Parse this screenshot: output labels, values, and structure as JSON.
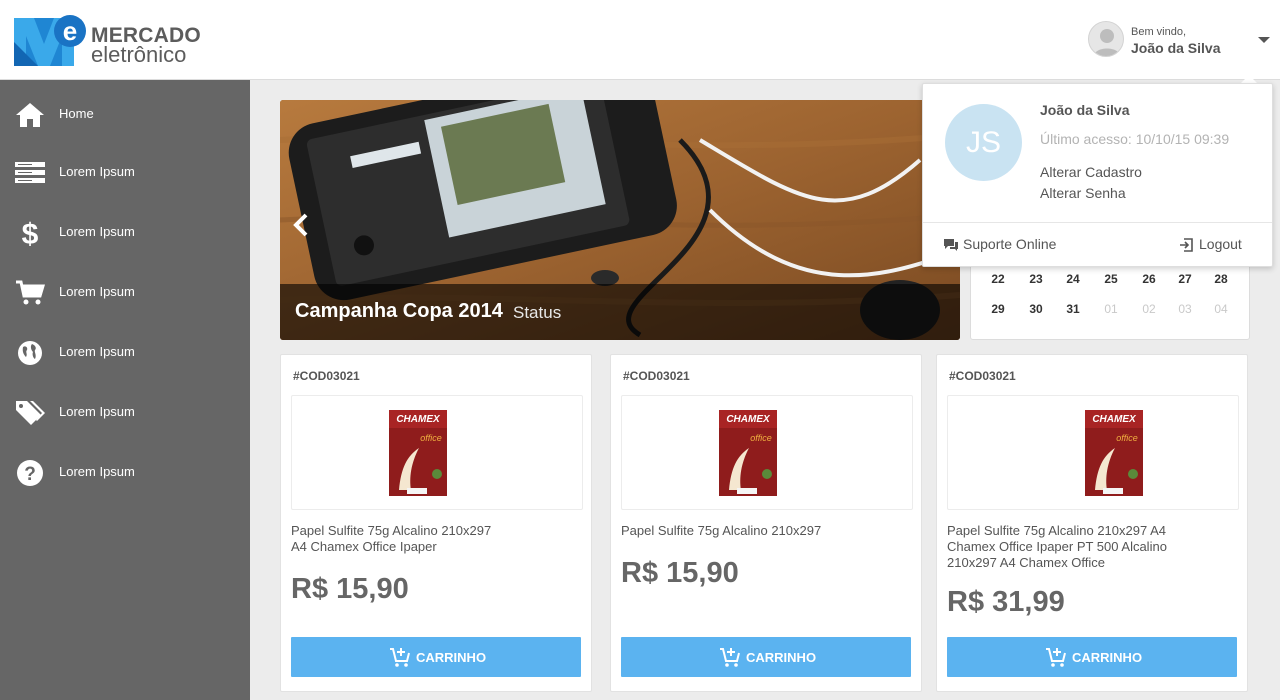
{
  "brand": {
    "line1": "MERCADO",
    "line2": "eletrônico",
    "accent": "#1e88d8"
  },
  "header": {
    "welcome": "Bem vindo,",
    "user_name": "João da Silva"
  },
  "sidebar": {
    "items": [
      {
        "label": "Home",
        "icon": "home-icon"
      },
      {
        "label": "Lorem Ipsum",
        "icon": "list-icon"
      },
      {
        "label": "Lorem Ipsum",
        "icon": "dollar-icon"
      },
      {
        "label": "Lorem Ipsum",
        "icon": "cart-icon"
      },
      {
        "label": "Lorem Ipsum",
        "icon": "globe-icon"
      },
      {
        "label": "Lorem Ipsum",
        "icon": "tags-icon"
      },
      {
        "label": "Lorem Ipsum",
        "icon": "help-icon"
      }
    ]
  },
  "banner": {
    "title": "Campanha Copa 2014",
    "status": "Status"
  },
  "calendar": {
    "rows": [
      [
        {
          "d": "22",
          "muted": false
        },
        {
          "d": "23",
          "muted": false
        },
        {
          "d": "24",
          "muted": false
        },
        {
          "d": "25",
          "muted": false
        },
        {
          "d": "26",
          "muted": false
        },
        {
          "d": "27",
          "muted": false
        },
        {
          "d": "28",
          "muted": false
        }
      ],
      [
        {
          "d": "29",
          "muted": false
        },
        {
          "d": "30",
          "muted": false
        },
        {
          "d": "31",
          "muted": false
        },
        {
          "d": "01",
          "muted": true
        },
        {
          "d": "02",
          "muted": true
        },
        {
          "d": "03",
          "muted": true
        },
        {
          "d": "04",
          "muted": true
        }
      ]
    ]
  },
  "user_menu": {
    "initials": "JS",
    "name": "João da Silva",
    "last_access": "Último acesso: 10/10/15 09:39",
    "edit_profile": "Alterar Cadastro",
    "change_password": "Alterar Senha",
    "support": "Suporte Online",
    "logout": "Logout"
  },
  "products": [
    {
      "code": "#COD03021",
      "name_lines": [
        "Papel Sulfite 75g Alcalino 210x297",
        "A4 Chamex Office Ipaper"
      ],
      "price": "R$ 15,90",
      "button": "CARRINHO"
    },
    {
      "code": "#COD03021",
      "name_lines": [
        "Papel Sulfite 75g Alcalino 210x297"
      ],
      "price": "R$ 15,90",
      "button": "CARRINHO"
    },
    {
      "code": "#COD03021",
      "name_lines": [
        "Papel Sulfite 75g Alcalino 210x297 A4",
        "Chamex Office Ipaper PT 500 Alcalino",
        "210x297 A4 Chamex Office"
      ],
      "price": "R$ 31,99",
      "button": "CARRINHO"
    }
  ],
  "product_image": {
    "brand": "CHAMEX",
    "sub": "office"
  }
}
